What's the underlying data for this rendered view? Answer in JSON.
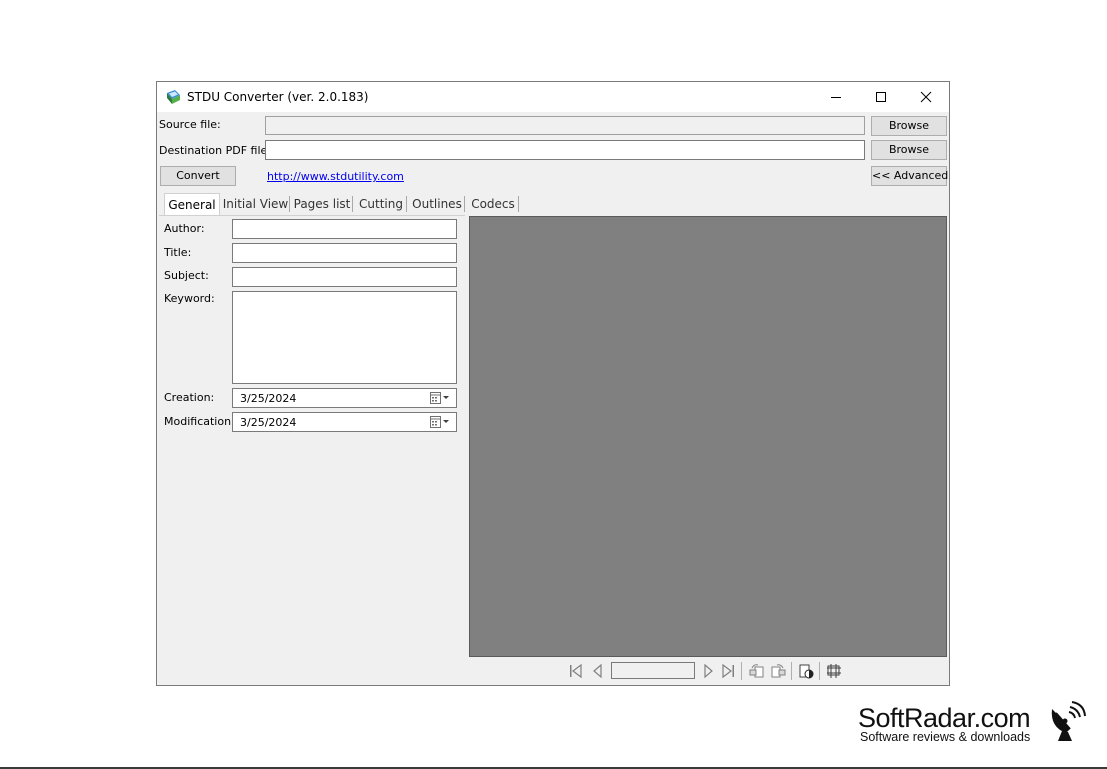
{
  "window": {
    "title": "STDU Converter (ver. 2.0.183)"
  },
  "top": {
    "source_label": "Source file:",
    "source_value": "",
    "dest_label": "Destination PDF file:",
    "dest_value": "",
    "browse_label": "Browse",
    "convert_label": "Convert",
    "link_text": "http://www.stdutility.com ",
    "advanced_label": "<< Advanced"
  },
  "tabs": [
    {
      "label": "General",
      "active": true
    },
    {
      "label": "Initial View"
    },
    {
      "label": "Pages list"
    },
    {
      "label": "Cutting"
    },
    {
      "label": "Outlines"
    },
    {
      "label": "Codecs"
    }
  ],
  "general": {
    "author_label": "Author:",
    "author_value": "",
    "title_label": "Title:",
    "title_value": "",
    "subject_label": "Subject:",
    "subject_value": "",
    "keyword_label": "Keyword:",
    "keyword_value": "",
    "creation_label": "Creation:",
    "creation_value": "3/25/2024",
    "modification_label": "Modification:",
    "modification_value": "3/25/2024"
  },
  "navbar": {
    "page_value": ""
  },
  "watermark": {
    "name": "SoftRadar.com",
    "tagline": "Software reviews & downloads"
  },
  "colors": {
    "preview_bg": "#808080",
    "window_bg": "#f0f0f0",
    "link": "#0000ee"
  },
  "icons": [
    "app-icon",
    "minimize-icon",
    "maximize-icon",
    "close-icon",
    "calendar-icon",
    "first-page-icon",
    "prev-page-icon",
    "next-page-icon",
    "last-page-icon",
    "rotate-left-icon",
    "rotate-right-icon",
    "page-contrast-icon",
    "grid-icon",
    "satellite-dish-icon"
  ]
}
